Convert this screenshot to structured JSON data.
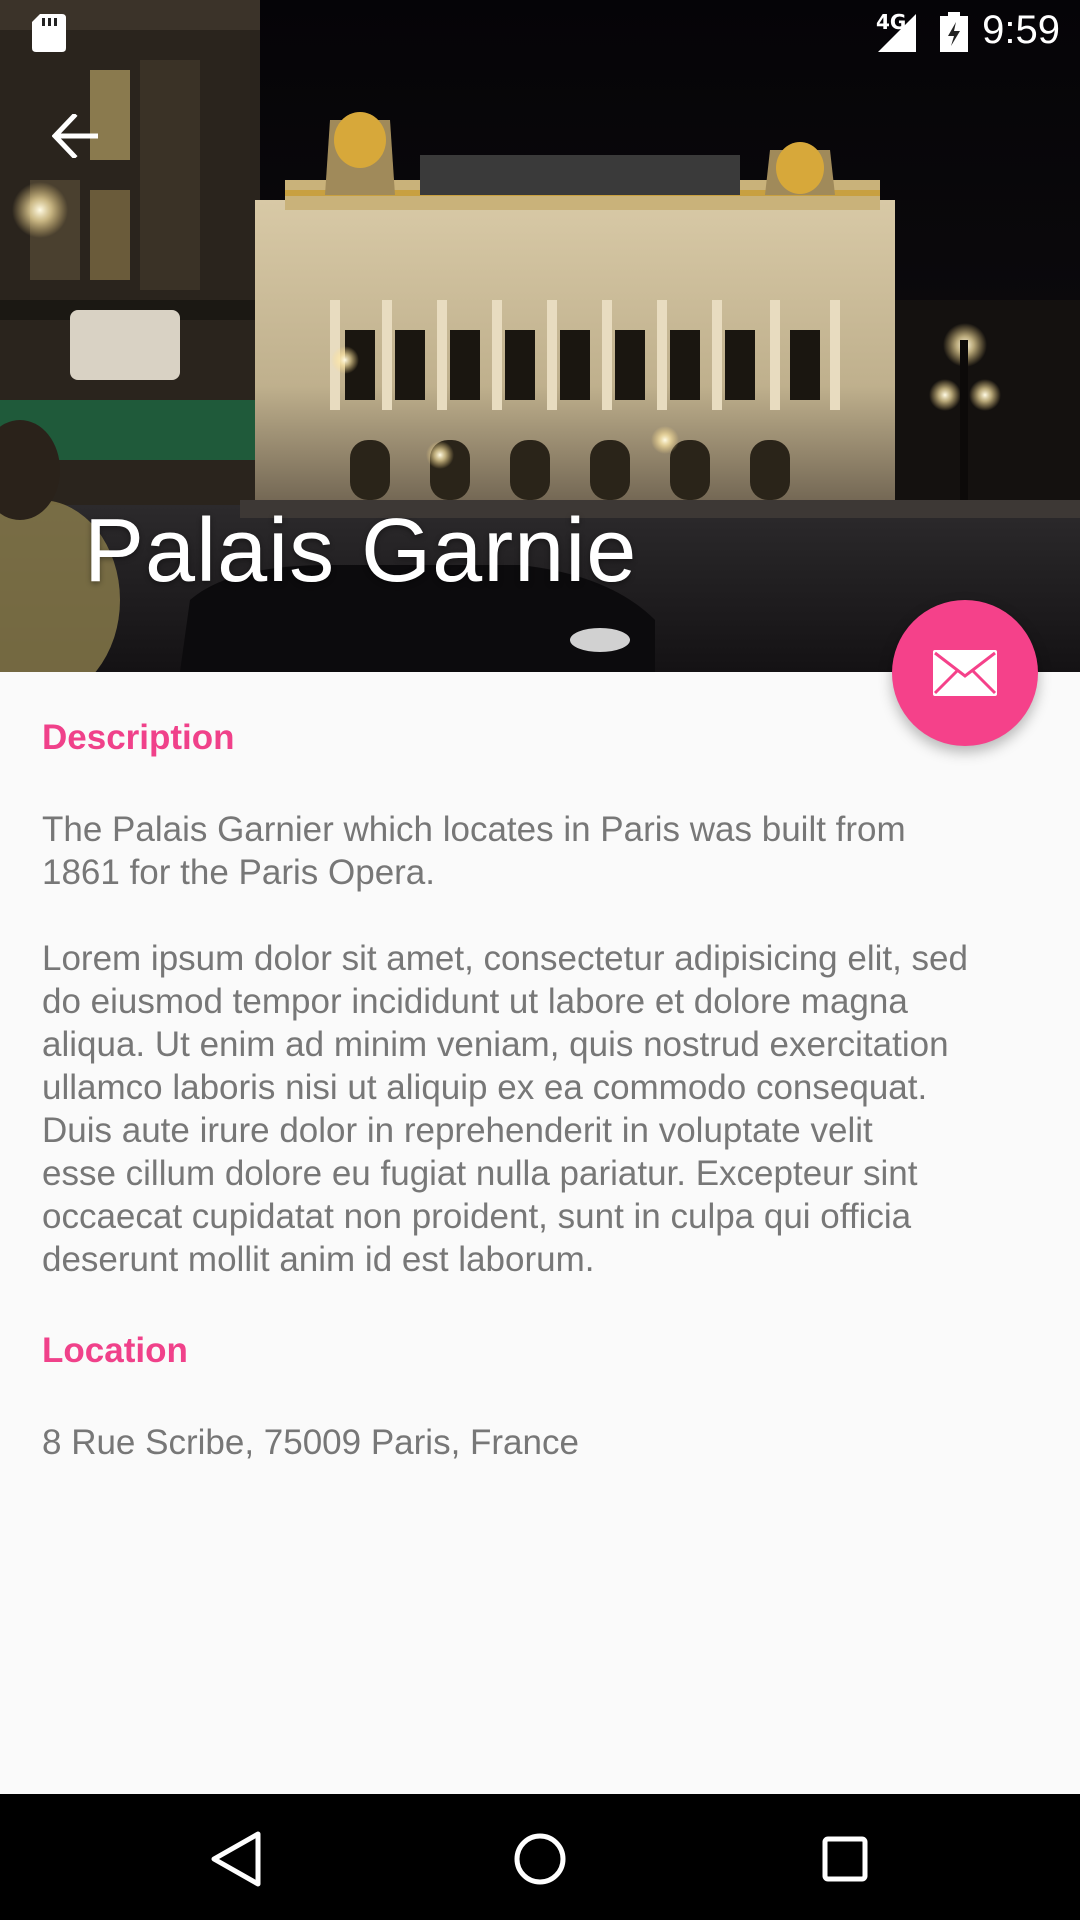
{
  "status_bar": {
    "time": "9:59",
    "network": "4G",
    "icons": [
      "sd-card-icon",
      "signal-icon",
      "battery-charging-icon"
    ]
  },
  "header": {
    "title": "Palais Garnie",
    "back_icon": "arrow-back-icon",
    "fab_icon": "mail-icon"
  },
  "sections": {
    "description_title": "Description",
    "description_intro": "The Palais Garnier which locates in Paris was built from\n1861 for the Paris Opera.",
    "description_body": "Lorem ipsum dolor sit amet, consectetur adipisicing elit, sed\ndo eiusmod tempor incididunt ut labore et dolore magna\naliqua. Ut enim ad minim veniam, quis nostrud exercitation\nullamco laboris nisi ut aliquip ex ea commodo consequat.\nDuis aute irure dolor in reprehenderit in voluptate velit\nesse cillum dolore eu fugiat nulla pariatur. Excepteur sint\noccaecat cupidatat non proident, sunt in culpa qui officia\ndeserunt mollit anim id est laborum.",
    "location_title": "Location",
    "location_text": "8 Rue Scribe, 75009 Paris, France"
  },
  "nav_bar": {
    "icons": [
      "back-triangle-icon",
      "home-circle-icon",
      "recents-square-icon"
    ]
  },
  "colors": {
    "accent": "#f5418a",
    "section_title": "#f0418a",
    "body_text": "#777777",
    "background": "#fafafa"
  }
}
